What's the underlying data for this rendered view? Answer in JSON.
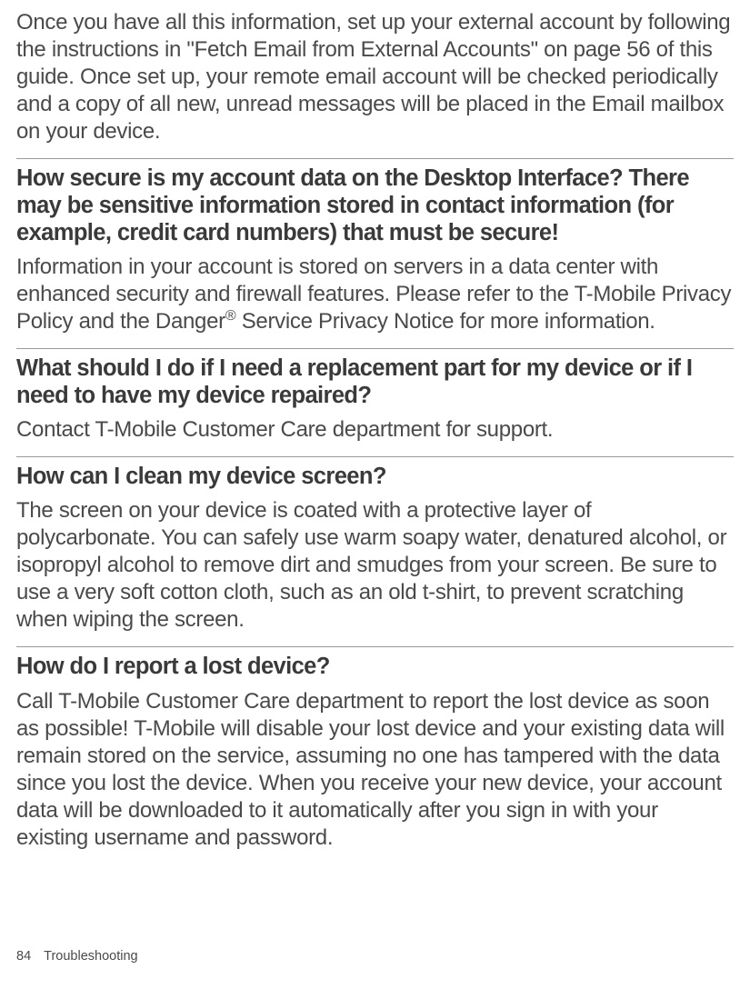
{
  "intro": "Once you have all this information, set up your external account by following the instructions in \"Fetch Email from External Accounts\" on page 56 of this guide. Once set up, your remote email account will be checked periodically and a copy of all new, unread messages will be placed in the Email mailbox on your device.",
  "sections": {
    "secure": {
      "question": "How secure is my account data on the Desktop Interface? There may be sensitive information stored in contact information (for example, credit card numbers) that must be secure!",
      "answer_before": "Information in your account is stored on servers in a data center with enhanced security and firewall features. Please refer to the T-Mobile Privacy Policy and the Danger",
      "reg": "®",
      "answer_after": " Service Privacy Notice for more information."
    },
    "replacement": {
      "question": "What should I do if I need a replacement part for my device or if I need to have my device repaired?",
      "answer": "Contact T-Mobile Customer Care department for support."
    },
    "clean": {
      "question": "How can I clean my device screen?",
      "answer": "The screen on your device is coated with a protective layer of polycarbonate. You can safely use warm soapy water, denatured alcohol, or isopropyl alcohol to remove dirt and smudges from your screen. Be sure to use a very soft cotton cloth, such as an old t-shirt, to prevent scratching when wiping the screen."
    },
    "lost": {
      "question": "How do I report a lost device?",
      "answer": "Call T-Mobile Customer Care department to report the lost device as soon as possible! T-Mobile will disable your lost device and your existing data will remain stored on the service, assuming no one has tampered with the data since you lost the device. When you receive your new device, your account data will be downloaded to it automatically after you sign in with your existing username and password."
    }
  },
  "footer": {
    "page": "84",
    "section": "Troubleshooting"
  }
}
